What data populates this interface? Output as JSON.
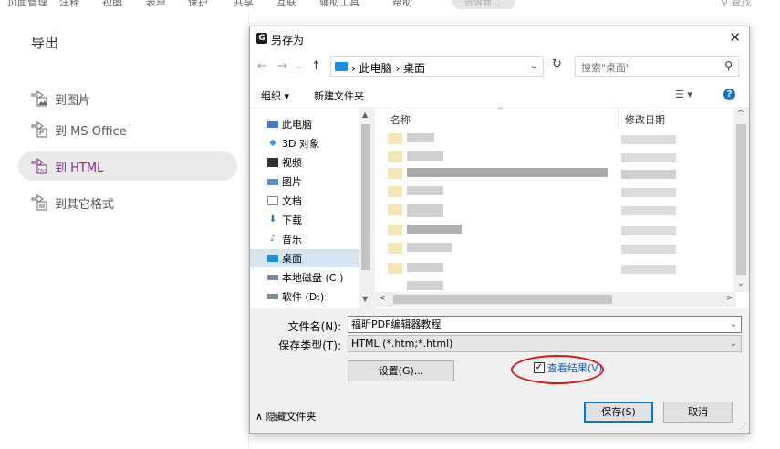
{
  "ribbon": {
    "tabs": [
      "页面管理",
      "注释",
      "视图",
      "表单",
      "保护",
      "共享",
      "互联",
      "辅助工具",
      "帮助"
    ],
    "hint": "告诉我...",
    "search_label": "查找"
  },
  "export_panel": {
    "title": "导出",
    "items": [
      {
        "label": "到图片",
        "selected": false
      },
      {
        "label": "到 MS Office",
        "selected": false
      },
      {
        "label": "到 HTML",
        "selected": true
      },
      {
        "label": "到其它格式",
        "selected": false
      }
    ]
  },
  "dialog": {
    "title": "另存为",
    "breadcrumb": [
      "此电脑",
      "桌面"
    ],
    "search_placeholder": "搜索\"桌面\"",
    "toolbar": {
      "organize": "组织 ▾",
      "new_folder": "新建文件夹"
    },
    "tree": [
      {
        "label": "此电脑",
        "icon": "pc-icon"
      },
      {
        "label": "3D 对象",
        "icon": "cube-icon"
      },
      {
        "label": "视频",
        "icon": "video-icon"
      },
      {
        "label": "图片",
        "icon": "picture-icon"
      },
      {
        "label": "文档",
        "icon": "document-icon"
      },
      {
        "label": "下载",
        "icon": "download-icon"
      },
      {
        "label": "音乐",
        "icon": "music-icon"
      },
      {
        "label": "桌面",
        "icon": "desktop-icon",
        "selected": true
      },
      {
        "label": "本地磁盘 (C:)",
        "icon": "drive-icon"
      },
      {
        "label": "软件 (D:)",
        "icon": "drive-icon"
      }
    ],
    "columns": {
      "name": "名称",
      "date": "修改日期"
    },
    "filename_label": "文件名(N):",
    "filename_value": "福昕PDF编辑器教程",
    "filetype_label": "保存类型(T):",
    "filetype_value": "HTML (*.htm;*.html)",
    "settings_button": "设置(G)...",
    "view_result_label": "查看结果(V)",
    "view_result_checked": true,
    "hide_folders": "隐藏文件夹",
    "save_button": "保存(S)",
    "cancel_button": "取消"
  }
}
